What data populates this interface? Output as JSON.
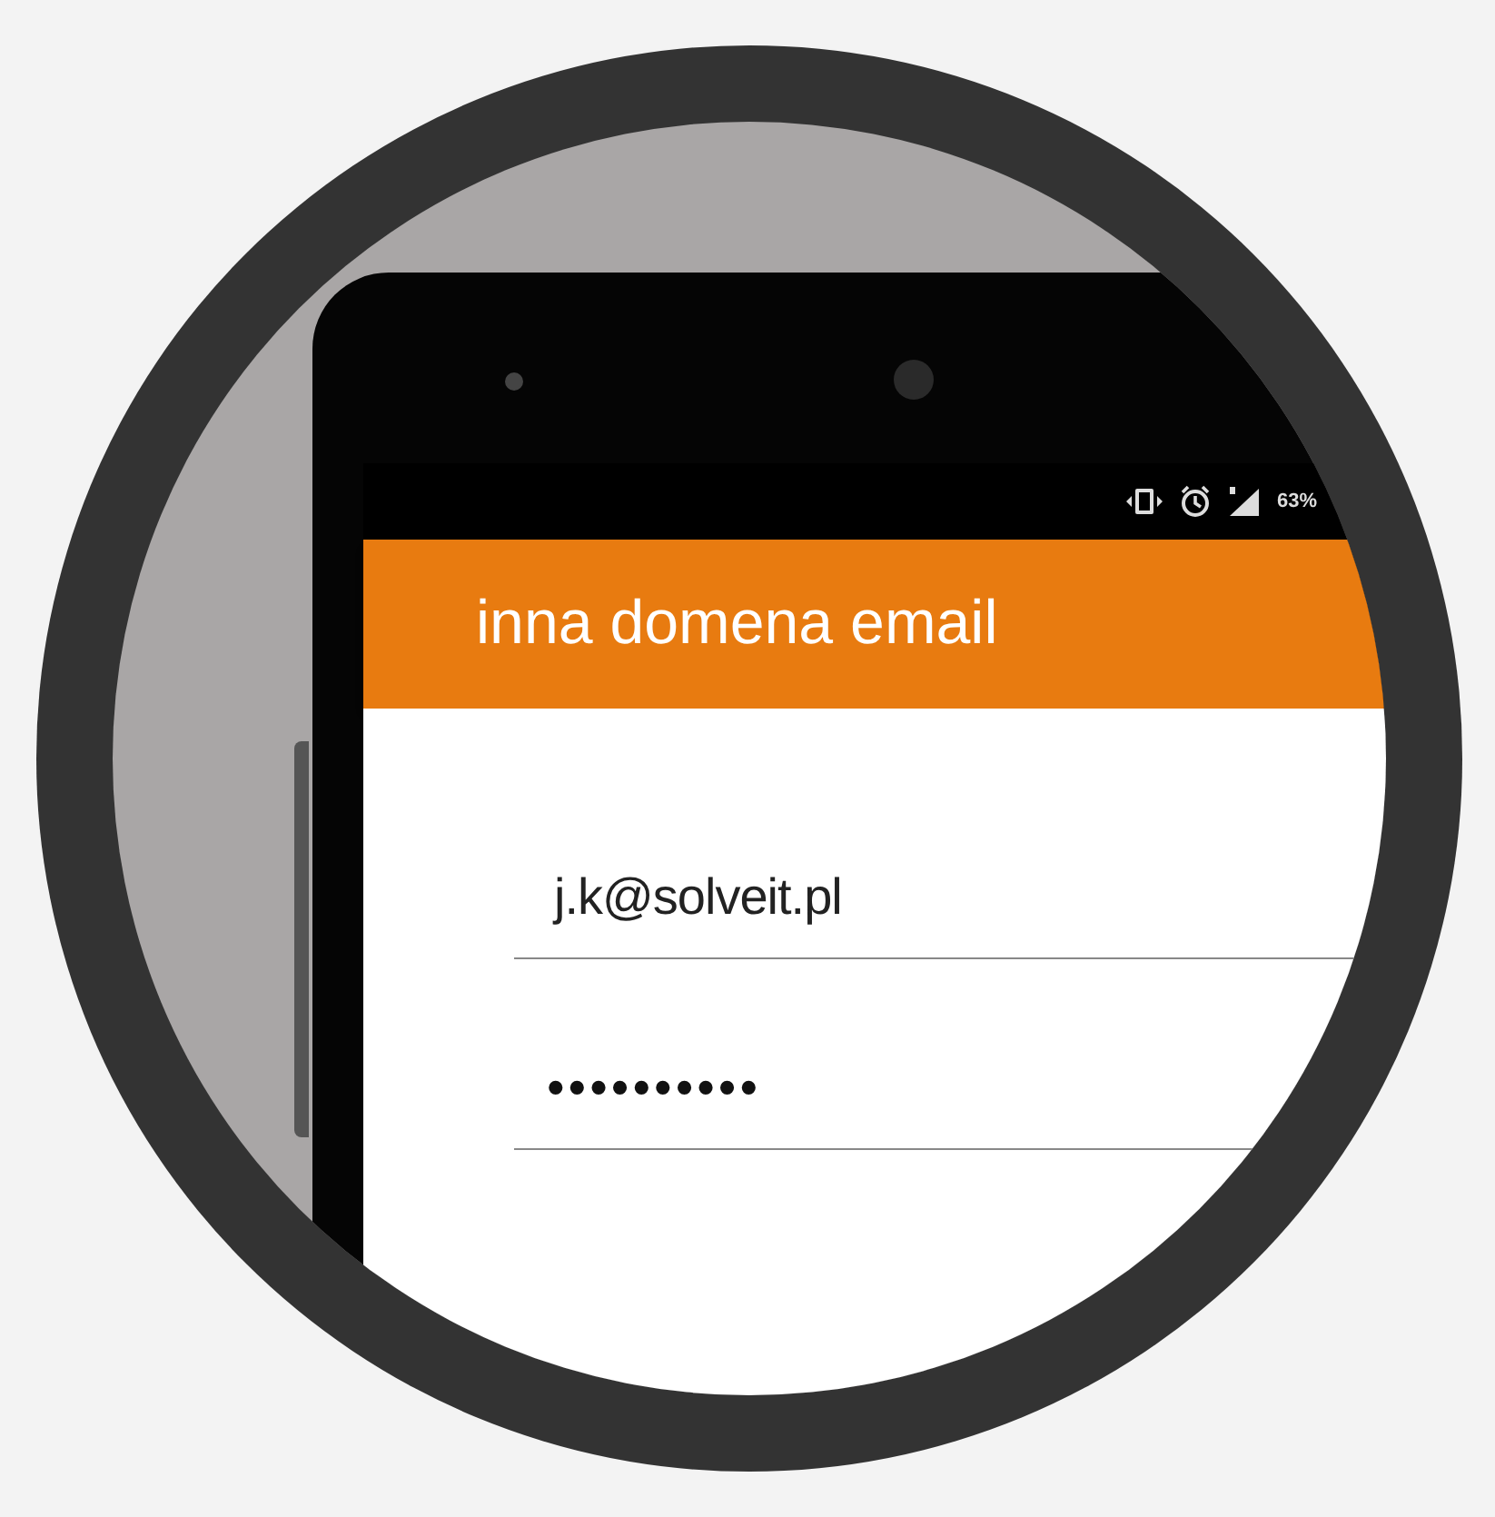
{
  "status_bar": {
    "battery": "63%"
  },
  "app_bar": {
    "title": "inna domena email"
  },
  "form": {
    "email": {
      "value": "j.k@solveit.pl"
    },
    "password": {
      "value": "••••••••••"
    }
  }
}
